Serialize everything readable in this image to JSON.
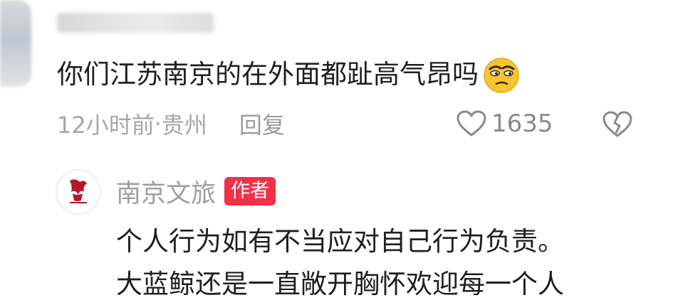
{
  "top_comment": {
    "username": "",
    "text": "你们江苏南京的在外面都趾高气昂吗",
    "emoji": "squinting-face-emoji",
    "time": "12小时前",
    "separator": " · ",
    "location": "贵州",
    "reply_label": "回复",
    "like_count": "1635"
  },
  "author_reply": {
    "name": "南京文旅",
    "badge": "作者",
    "line1": "个人行为如有不当应对自己行为负责。",
    "line2": "大蓝鲸还是一直敞开胸怀欢迎每一个人",
    "avatar_icon": "nanjing-logo-icon"
  },
  "colors": {
    "badge": "#f2304a",
    "meta_text": "#a6a6a6",
    "body_text": "#1f1f1f"
  }
}
